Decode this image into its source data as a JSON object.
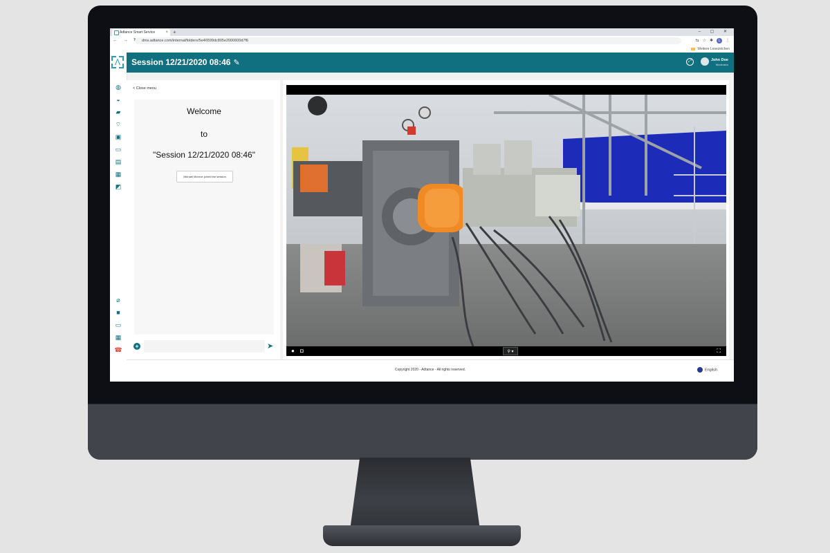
{
  "browser": {
    "tab_title": "Adtance Smart Service",
    "new_tab": "+",
    "tab_close": "×",
    "window_controls": "–  ▢  ✕",
    "nav_glyphs": "← → ↻",
    "url": "dms.adtance.com/internal/folders/5e46599dc805e2000600d7f6",
    "bookmarks_label": "Weitere Lesezeichen",
    "profile_initial": "L"
  },
  "header": {
    "title": "Session 12/21/2020 08:46",
    "user_name": "John Doe",
    "user_role": "Moderator"
  },
  "chat": {
    "close_menu": "< Close menu",
    "welcome_line1": "Welcome",
    "welcome_line2": "to",
    "welcome_line3": "\"Session 12/21/2020 08:46\"",
    "joined_message": "Michael Monroe joined the session",
    "input_placeholder": ""
  },
  "footer": {
    "copyright": "Copyright 2020 - Adtance - All rights reserved.",
    "language": "English"
  },
  "sidebar_icons": [
    "globe-icon",
    "dashboard-icon",
    "chat-icon",
    "signal-icon",
    "image-icon",
    "screen-share-icon",
    "document-icon",
    "film-icon",
    "pen-icon",
    "mic-off-icon",
    "video-icon",
    "monitor-icon",
    "grid-icon",
    "hangup-icon"
  ],
  "colors": {
    "brand": "#11707f",
    "accent": "#2a9bb0",
    "danger": "#e0443a"
  }
}
